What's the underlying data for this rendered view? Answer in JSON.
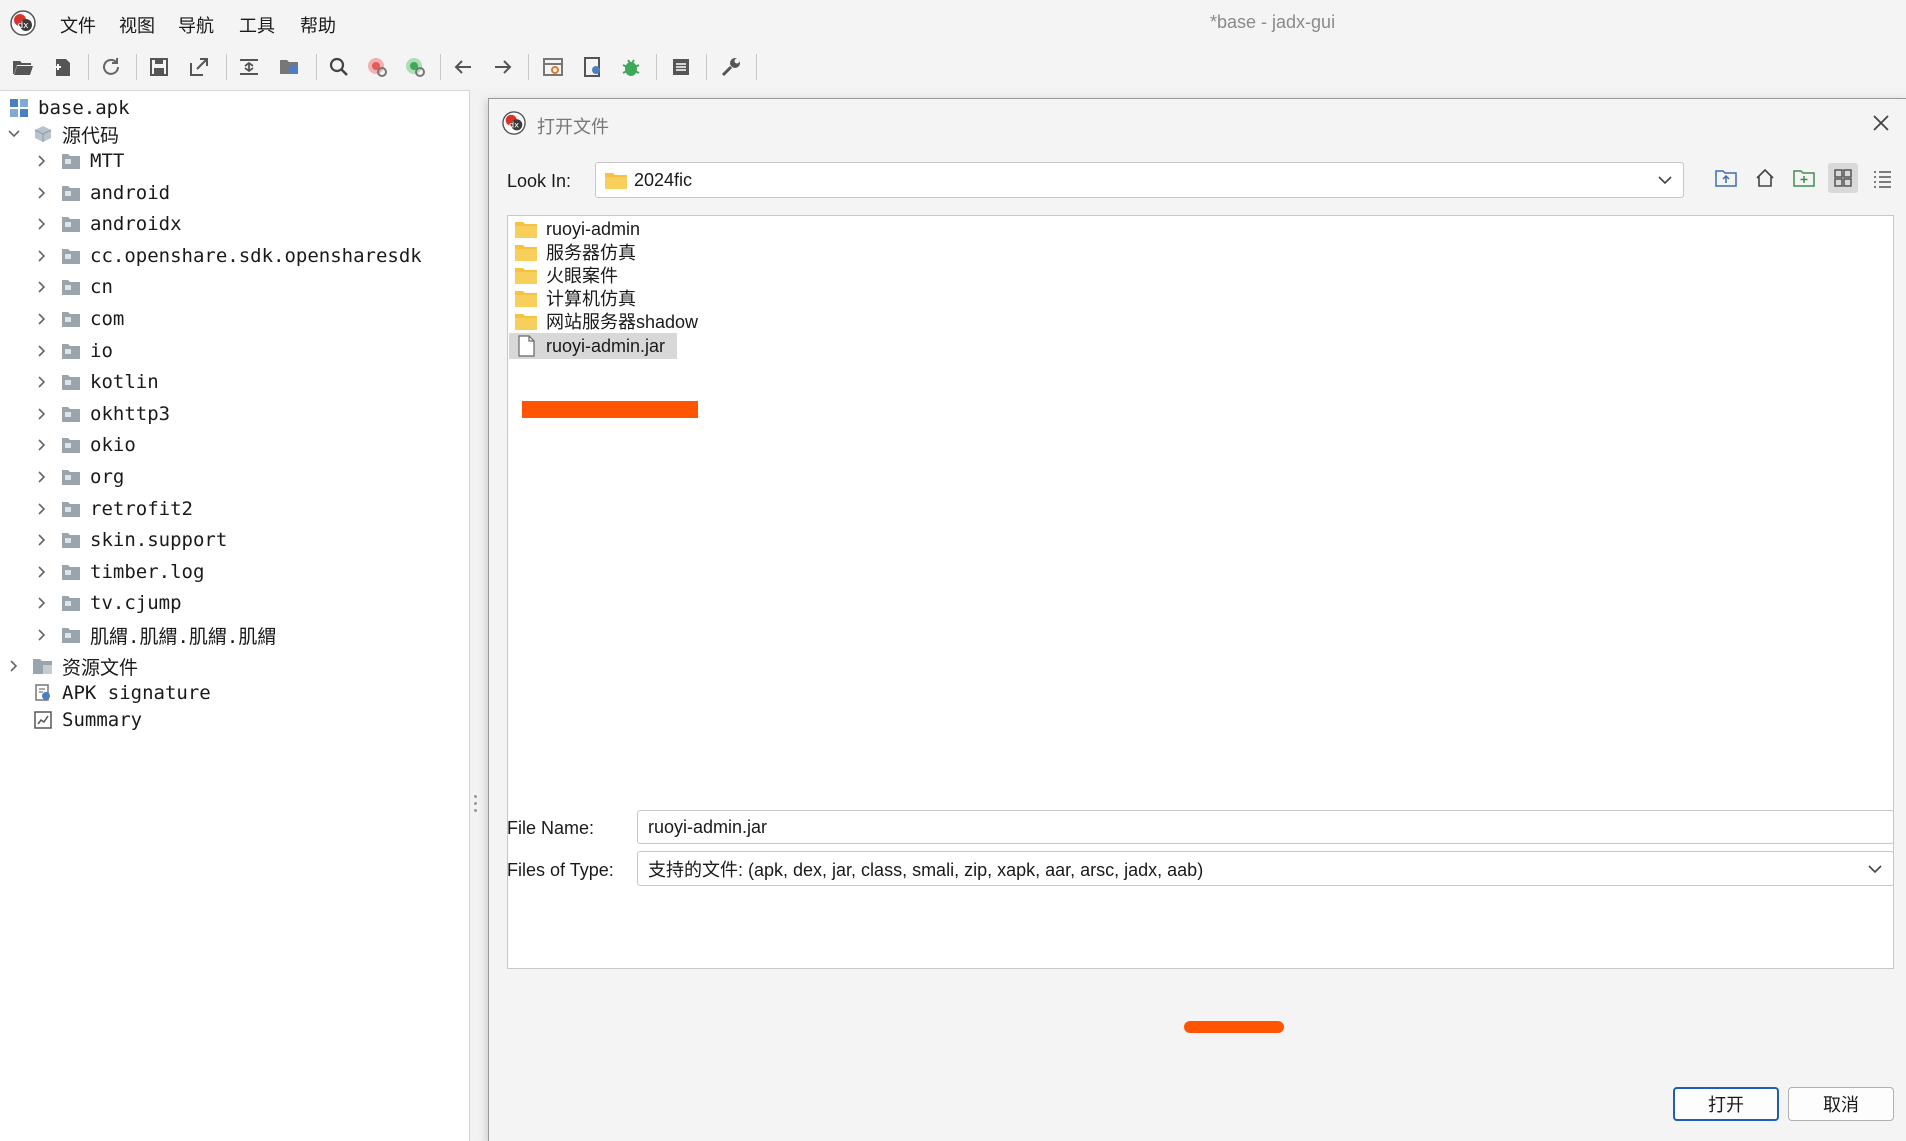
{
  "window": {
    "title": "*base - jadx-gui"
  },
  "menu": [
    "文件",
    "视图",
    "导航",
    "工具",
    "帮助"
  ],
  "toolbar": {
    "icons": [
      "open-file-icon",
      "add-files-icon",
      "reload-icon",
      "save-icon",
      "export-icon",
      "sync-tree-icon",
      "flatten-packages-icon",
      "search-icon",
      "find-class-icon",
      "find-usage-icon",
      "back-icon",
      "forward-icon",
      "deobfuscation-icon",
      "quark-icon",
      "debug-icon",
      "log-icon",
      "preferences-icon"
    ]
  },
  "tree": {
    "root": "base.apk",
    "source_node": "源代码",
    "packages": [
      "MTT",
      "android",
      "androidx",
      "cc.openshare.sdk.opensharesdk",
      "cn",
      "com",
      "io",
      "kotlin",
      "okhttp3",
      "okio",
      "org",
      "retrofit2",
      "skin.support",
      "timber.log",
      "tv.cjump",
      "肌緭.肌緭.肌緭.肌緭"
    ],
    "resources_node": "资源文件",
    "signature_node": "APK signature",
    "summary_node": "Summary"
  },
  "dialog": {
    "title": "打开文件",
    "look_in_label": "Look In:",
    "look_in_value": "2024fic",
    "files": [
      {
        "name": "ruoyi-admin",
        "type": "folder",
        "selected": false
      },
      {
        "name": "服务器仿真",
        "type": "folder",
        "selected": false
      },
      {
        "name": "火眼案件",
        "type": "folder",
        "selected": false
      },
      {
        "name": "计算机仿真",
        "type": "folder",
        "selected": false
      },
      {
        "name": "网站服务器shadow",
        "type": "folder",
        "selected": false
      },
      {
        "name": "ruoyi-admin.jar",
        "type": "file",
        "selected": true
      }
    ],
    "file_name_label": "File Name:",
    "file_name_value": "ruoyi-admin.jar",
    "file_type_label": "Files of Type:",
    "file_type_value": "支持的文件: (apk, dex, jar, class, smali, zip, xapk, aar, arsc, jadx, aab)",
    "open_button": "打开",
    "cancel_button": "取消"
  },
  "colors": {
    "accent": "#1d5fb8",
    "annotation": "#ff5500",
    "folder": "#f5c242",
    "selection": "#d8d8d8"
  }
}
